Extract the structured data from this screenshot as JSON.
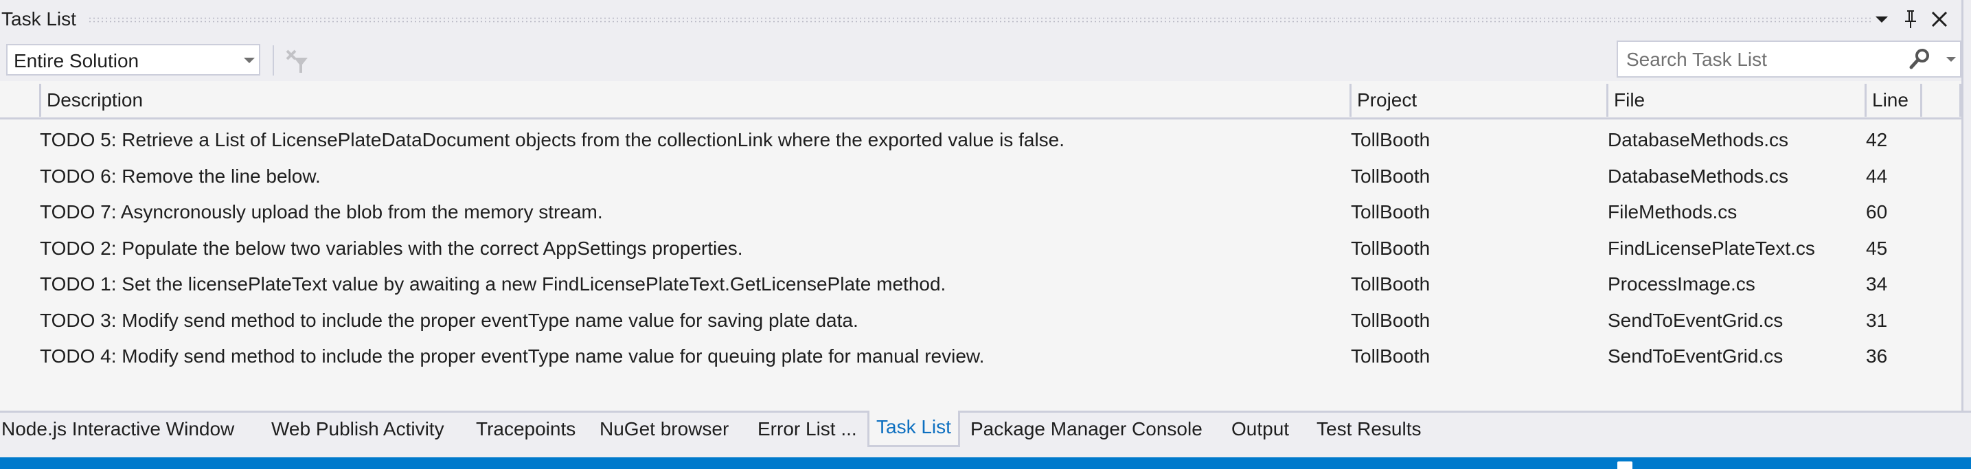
{
  "window": {
    "title": "Task List",
    "icons": [
      "dropdown-arrow-icon",
      "pin-icon",
      "close-icon"
    ]
  },
  "toolbar": {
    "scope_value": "Entire Solution",
    "clear_filter_icon": "filter-clear-icon",
    "search_placeholder": "Search Task List"
  },
  "table": {
    "columns": [
      "Description",
      "Project",
      "File",
      "Line"
    ],
    "rows": [
      {
        "description": "TODO 5: Retrieve a List of LicensePlateDataDocument objects from the collectionLink where the exported value is false.",
        "project": "TollBooth",
        "file": "DatabaseMethods.cs",
        "line": "42"
      },
      {
        "description": "TODO 6: Remove the line below.",
        "project": "TollBooth",
        "file": "DatabaseMethods.cs",
        "line": "44"
      },
      {
        "description": "TODO 7: Asyncronously upload the blob from the memory stream.",
        "project": "TollBooth",
        "file": "FileMethods.cs",
        "line": "60"
      },
      {
        "description": "TODO 2: Populate the below two variables with the correct AppSettings properties.",
        "project": "TollBooth",
        "file": "FindLicensePlateText.cs",
        "line": "45"
      },
      {
        "description": "TODO 1: Set the licensePlateText value by awaiting a new FindLicensePlateText.GetLicensePlate method.",
        "project": "TollBooth",
        "file": "ProcessImage.cs",
        "line": "34"
      },
      {
        "description": "TODO 3: Modify send method to include the proper eventType name value for saving plate data.",
        "project": "TollBooth",
        "file": "SendToEventGrid.cs",
        "line": "31"
      },
      {
        "description": "TODO 4: Modify send method to include the proper eventType name value for queuing plate for manual review.",
        "project": "TollBooth",
        "file": "SendToEventGrid.cs",
        "line": "36"
      }
    ]
  },
  "tabs": {
    "items": [
      "Node.js Interactive Window",
      "Web Publish Activity",
      "Tracepoints",
      "NuGet browser",
      "Error List ...",
      "Task List",
      "Package Manager Console",
      "Output",
      "Test Results"
    ],
    "active": "Task List"
  },
  "colors": {
    "accent": "#007acc",
    "active_tab_text": "#0e70c0",
    "background": "#eeeef2",
    "grid_background": "#f5f5f5",
    "border": "#cccedb"
  }
}
